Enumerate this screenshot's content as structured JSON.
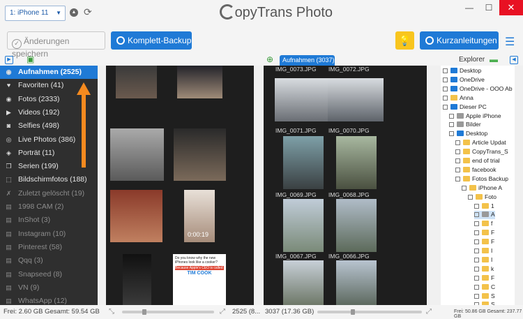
{
  "header": {
    "device": "1: iPhone 11",
    "app_title": "opyTrans Photo",
    "logo_letter": "C"
  },
  "toolbar": {
    "save_label": "Änderungen speichern",
    "backup_label": "Komplett-Backup",
    "guide_label": "Kurzanleitungen"
  },
  "tabs": {
    "device_tab": "Aufnahmen (3037)",
    "explorer": "Explorer"
  },
  "sidebar": {
    "items": [
      {
        "label": "Aufnahmen (2525)",
        "icon": "camera-icon",
        "active": true
      },
      {
        "label": "Favoriten (41)",
        "icon": "heart-icon"
      },
      {
        "label": "Fotos (2333)",
        "icon": "camera-icon"
      },
      {
        "label": "Videos (192)",
        "icon": "video-icon"
      },
      {
        "label": "Selfies (498)",
        "icon": "portrait-icon"
      },
      {
        "label": "Live Photos (386)",
        "icon": "live-icon"
      },
      {
        "label": "Porträt (11)",
        "icon": "cube-icon"
      },
      {
        "label": "Serien (199)",
        "icon": "stack-icon"
      },
      {
        "label": "Bildschirmfotos (188)",
        "icon": "screenshot-icon"
      },
      {
        "label": "Zuletzt gelöscht (19)",
        "icon": "trash-icon",
        "dim": true
      },
      {
        "label": "1998 CAM (2)",
        "icon": "album-icon",
        "dim": true
      },
      {
        "label": "InShot (3)",
        "icon": "album-icon",
        "dim": true
      },
      {
        "label": "Instagram (10)",
        "icon": "album-icon",
        "dim": true
      },
      {
        "label": "Pinterest (58)",
        "icon": "album-icon",
        "dim": true
      },
      {
        "label": "Qqq (3)",
        "icon": "album-icon",
        "dim": true
      },
      {
        "label": "Snapseed (8)",
        "icon": "album-icon",
        "dim": true
      },
      {
        "label": "VN (9)",
        "icon": "album-icon",
        "dim": true
      },
      {
        "label": "WhatsApp (12)",
        "icon": "album-icon",
        "dim": true
      }
    ]
  },
  "pc_library": {
    "video_duration": "0:00:19",
    "meme_text1": "Do you know why the new iPhones look like a cooker?",
    "meme_text2": "Because Apple's CEO is called",
    "meme_text3": "TIM COOK",
    "count": "2525 (8..."
  },
  "device_photos": {
    "captions": [
      "IMG_0073.JPG",
      "IMG_0072.JPG",
      "IMG_0071.JPG",
      "IMG_0070.JPG",
      "IMG_0069.JPG",
      "IMG_0068.JPG",
      "IMG_0067.JPG",
      "IMG_0066.JPG"
    ],
    "count": "3037 (17.36 GB)"
  },
  "tree": [
    {
      "label": "Desktop",
      "type": "blue",
      "sel": false
    },
    {
      "label": "OneDrive",
      "type": "blue"
    },
    {
      "label": "OneDrive - OOO Ab",
      "type": "blue"
    },
    {
      "label": "Anna",
      "type": "yellow"
    },
    {
      "label": "Dieser PC",
      "type": "blue"
    },
    {
      "label": "Apple iPhone",
      "type": "grey"
    },
    {
      "label": "Bilder",
      "type": "grey"
    },
    {
      "label": "Desktop",
      "type": "blue"
    },
    {
      "label": "Article Updat",
      "type": "yellow"
    },
    {
      "label": "CopyTrans_S",
      "type": "yellow"
    },
    {
      "label": "end of trial",
      "type": "yellow"
    },
    {
      "label": "facebook",
      "type": "yellow"
    },
    {
      "label": "Fotos Backup",
      "type": "yellow"
    },
    {
      "label": "iPhone A",
      "type": "yellow"
    },
    {
      "label": "Foto",
      "type": "yellow"
    },
    {
      "label": "1",
      "type": "yellow"
    },
    {
      "label": "A",
      "type": "grey",
      "sel": true
    },
    {
      "label": "f",
      "type": "yellow"
    },
    {
      "label": "F",
      "type": "yellow"
    },
    {
      "label": "F",
      "type": "yellow"
    },
    {
      "label": "I",
      "type": "yellow"
    },
    {
      "label": "I",
      "type": "yellow"
    },
    {
      "label": "k",
      "type": "yellow"
    },
    {
      "label": "F",
      "type": "yellow"
    },
    {
      "label": "C",
      "type": "yellow"
    },
    {
      "label": "S",
      "type": "yellow"
    },
    {
      "label": "S",
      "type": "yellow"
    }
  ],
  "status": {
    "left": "Frei: 2.60 GB Gesamt: 59.54 GB",
    "right": "Frei: 50.86 GB Gesamt: 237.77 GB"
  }
}
